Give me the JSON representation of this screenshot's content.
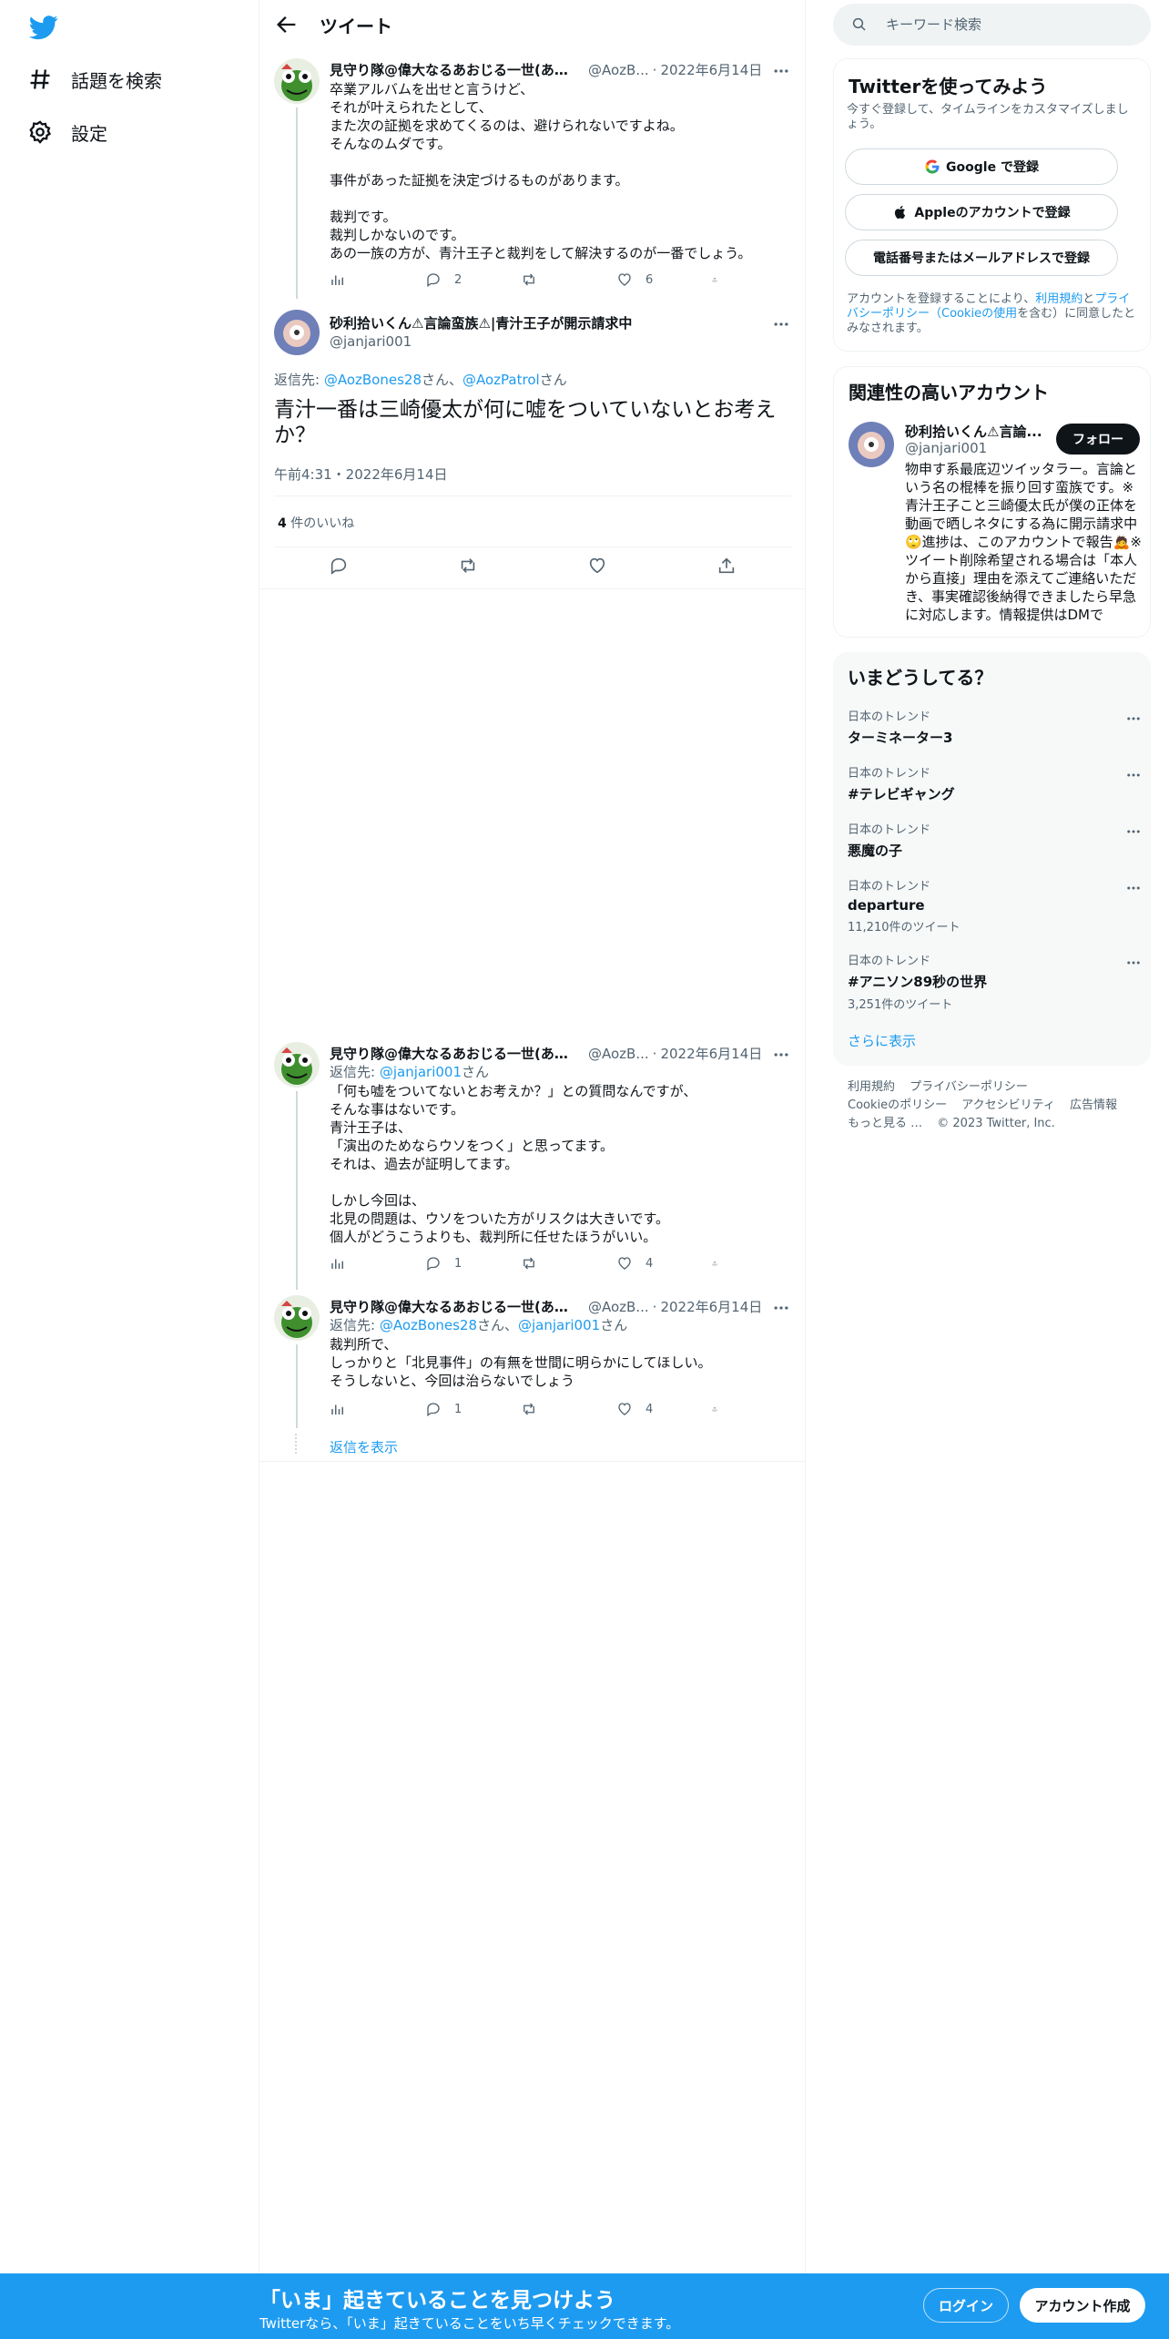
{
  "colors": {
    "accent": "#1d9bf0",
    "text": "#0f1419",
    "muted": "#536471",
    "border": "#eff3f4"
  },
  "nav": {
    "logo_icon": "twitter-bird-icon",
    "items": [
      {
        "icon": "hashtag-icon",
        "label": "話題を検索"
      },
      {
        "icon": "gear-icon",
        "label": "設定"
      }
    ]
  },
  "header": {
    "title": "ツイート"
  },
  "tweets": [
    {
      "name": "見守り隊@偉大なるあおじる一世(あお...",
      "handle": "@AozB...",
      "date": "2022年6月14日",
      "lines": [
        "卒業アルバムを出せと言うけど、",
        "それが叶えられたとして、",
        "また次の証拠を求めてくるのは、避けられないですよね。",
        "そんなのムダです。",
        "",
        "事件があった証拠を決定づけるものがあります。",
        "",
        "裁判です。",
        "裁判しかないのです。",
        "あの一族の方が、青汁王子と裁判をして解決するのが一番でしょう。"
      ],
      "stats": {
        "views": "",
        "replies": "2",
        "retweets": "",
        "likes": "6"
      }
    },
    {
      "name": "見守り隊@偉大なるあおじる一世(あお...",
      "handle": "@AozB...",
      "date": "2022年6月14日",
      "reply_prefix": "返信先: ",
      "reply_to": "@janjari001",
      "reply_suffix": "さん",
      "lines": [
        "「何も嘘をついてないとお考えか？」との質問なんですが、",
        "そんな事はないです。",
        "青汁王子は、",
        "「演出のためならウソをつく」と思ってます。",
        "それは、過去が証明してます。",
        "",
        "しかし今回は、",
        "北見の問題は、ウソをついた方がリスクは大きいです。",
        "個人がどうこうよりも、裁判所に任せたほうがいい。"
      ],
      "stats": {
        "views": "",
        "replies": "1",
        "retweets": "",
        "likes": "4"
      }
    },
    {
      "name": "見守り隊@偉大なるあおじる一世(あお...",
      "handle": "@AozB...",
      "date": "2022年6月14日",
      "reply_prefix": "返信先: ",
      "reply_to": "@AozBones28",
      "reply_mid": "さん、",
      "reply_to2": "@janjari001",
      "reply_suffix": "さん",
      "lines": [
        "裁判所で、",
        "しっかりと「北見事件」の有無を世間に明らかにしてほしい。",
        "そうしないと、今回は治らないでしょう"
      ],
      "stats": {
        "views": "",
        "replies": "1",
        "retweets": "",
        "likes": "4"
      }
    }
  ],
  "main_tweet": {
    "name": "砂利拾いくん⚠言論蛮族⚠|青汁王子が開示請求中",
    "handle": "@janjari001",
    "reply_prefix": "返信先: ",
    "reply_to": "@AozBones28",
    "reply_mid": "さん、",
    "reply_to2": "@AozPatrol",
    "reply_suffix": "さん",
    "text": "青汁一番は三崎優太が何に嘘をついていないとお考えか？",
    "time": "午前4:31・2022年6月14日",
    "likes_count": "4",
    "likes_label": " 件のいいね"
  },
  "show_replies": "返信を表示",
  "right": {
    "search_placeholder": "キーワード検索",
    "signup": {
      "title": "Twitterを使ってみよう",
      "subtitle": "今すぐ登録して、タイムラインをカスタマイズしましょう。",
      "google": "Google で登録",
      "apple": "Appleのアカウントで登録",
      "phone": "電話番号またはメールアドレスで登録",
      "terms_pre": "アカウントを登録することにより、",
      "terms_link": "利用規約",
      "terms_mid": "と",
      "privacy_link": "プライバシーポリシー",
      "cookie_link": "（Cookieの使用",
      "terms_post": "を含む）に同意したとみなされます。"
    },
    "related": {
      "title": "関連性の高いアカウント",
      "name": "砂利拾いくん⚠言論...",
      "handle": "@janjari001",
      "follow": "フォロー",
      "bio": "物申す系最底辺ツイッタラー。言論という名の棍棒を振り回す蛮族です。※青汁王子こと三崎優太氏が僕の正体を動画で晒しネタにする為に開示請求中🙄進捗は、このアカウントで報告🙇※ツイート削除希望される場合は「本人から直接」理由を添えてご連絡いただき、事実確認後納得できましたら早急に対応します。情報提供はDMで"
    },
    "trends": {
      "title": "いまどうしてる？",
      "items": [
        {
          "category": "日本のトレンド",
          "name": "ターミネーター3",
          "count": ""
        },
        {
          "category": "日本のトレンド",
          "name": "#テレビギャング",
          "count": ""
        },
        {
          "category": "日本のトレンド",
          "name": "悪魔の子",
          "count": ""
        },
        {
          "category": "日本のトレンド",
          "name": "departure",
          "count": "11,210件のツイート"
        },
        {
          "category": "日本のトレンド",
          "name": "#アニソン89秒の世界",
          "count": "3,251件のツイート"
        }
      ],
      "show_more": "さらに表示"
    },
    "footer": {
      "links": [
        "利用規約",
        "プライバシーポリシー",
        "Cookieのポリシー",
        "アクセシビリティ",
        "広告情報",
        "もっと見る …"
      ],
      "copyright": "© 2023 Twitter, Inc."
    }
  },
  "bottom_bar": {
    "title": "「いま」起きていることを見つけよう",
    "subtitle": "Twitterなら、「いま」起きていることをいち早くチェックできます。",
    "login": "ログイン",
    "signup": "アカウント作成"
  }
}
